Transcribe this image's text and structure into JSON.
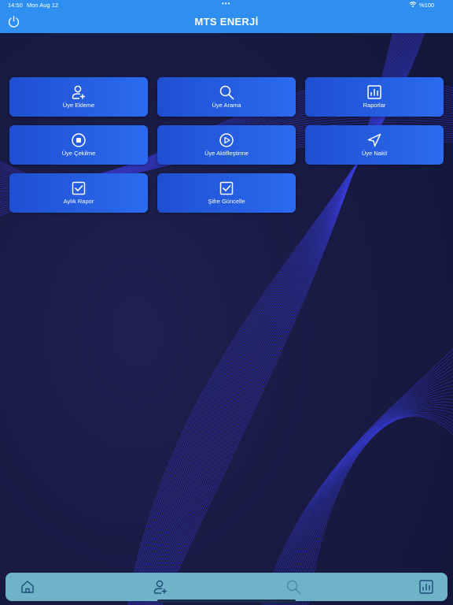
{
  "status_bar": {
    "time": "14:50",
    "date": "Mon Aug 12",
    "dots": "•••",
    "battery": "%100"
  },
  "header": {
    "title": "MTS ENERJİ",
    "power_icon": "power-icon"
  },
  "menu": [
    {
      "label": "Üye Ekleme",
      "icon": "add-user-icon"
    },
    {
      "label": "Üye Arama",
      "icon": "search-icon"
    },
    {
      "label": "Raporlar",
      "icon": "report-chart-icon"
    },
    {
      "label": "Üye Çekilme",
      "icon": "stop-circle-icon"
    },
    {
      "label": "Üye Aktifleştirme",
      "icon": "play-circle-icon"
    },
    {
      "label": "Üye Nakil",
      "icon": "navigation-arrow-icon"
    },
    {
      "label": "Aylık Rapor",
      "icon": "checkbox-icon"
    },
    {
      "label": "Şifre Güncelle",
      "icon": "checkbox-icon"
    }
  ],
  "tab_bar": {
    "tabs": [
      "home-icon",
      "add-user-icon",
      "search-icon",
      "report-chart-icon"
    ]
  },
  "colors": {
    "accent": "#2f8ff0",
    "card": "#2b6bef",
    "background": "#16193a",
    "tab_bar": "#6fb3c8",
    "lines": "#3b3fe0"
  }
}
